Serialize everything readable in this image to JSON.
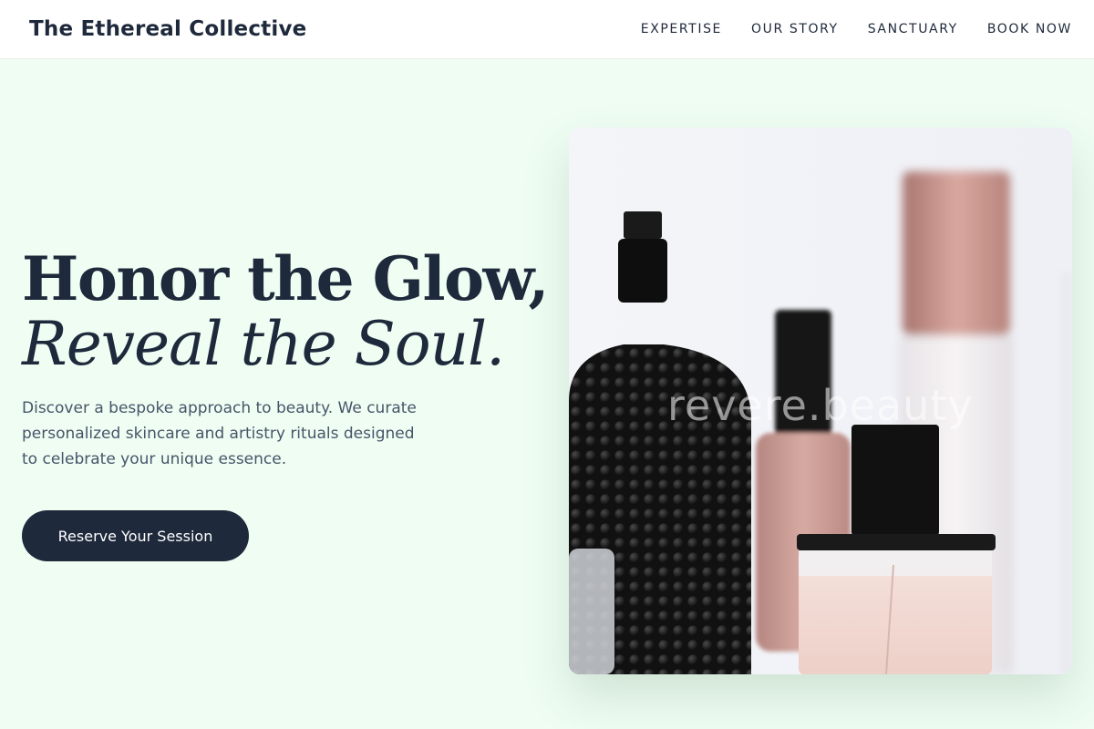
{
  "header": {
    "brand": "The Ethereal Collective",
    "nav": [
      {
        "label": "EXPERTISE"
      },
      {
        "label": "OUR STORY"
      },
      {
        "label": "SANCTUARY"
      },
      {
        "label": "BOOK NOW"
      }
    ]
  },
  "hero": {
    "title_line1": "Honor the Glow,",
    "title_line2": "Reveal the Soul.",
    "description": "Discover a bespoke approach to beauty. We curate personalized skincare and artistry rituals designed to celebrate your unique essence.",
    "cta_label": "Reserve Your Session",
    "image": {
      "subject": "perfume-and-cosmetic-bottles-photo",
      "watermark": "revere.beauty"
    }
  },
  "colors": {
    "page_background": "#effdf3",
    "header_background": "#ffffff",
    "primary_dark": "#1e293b",
    "body_text": "#475569",
    "cta_text": "#ffffff"
  }
}
